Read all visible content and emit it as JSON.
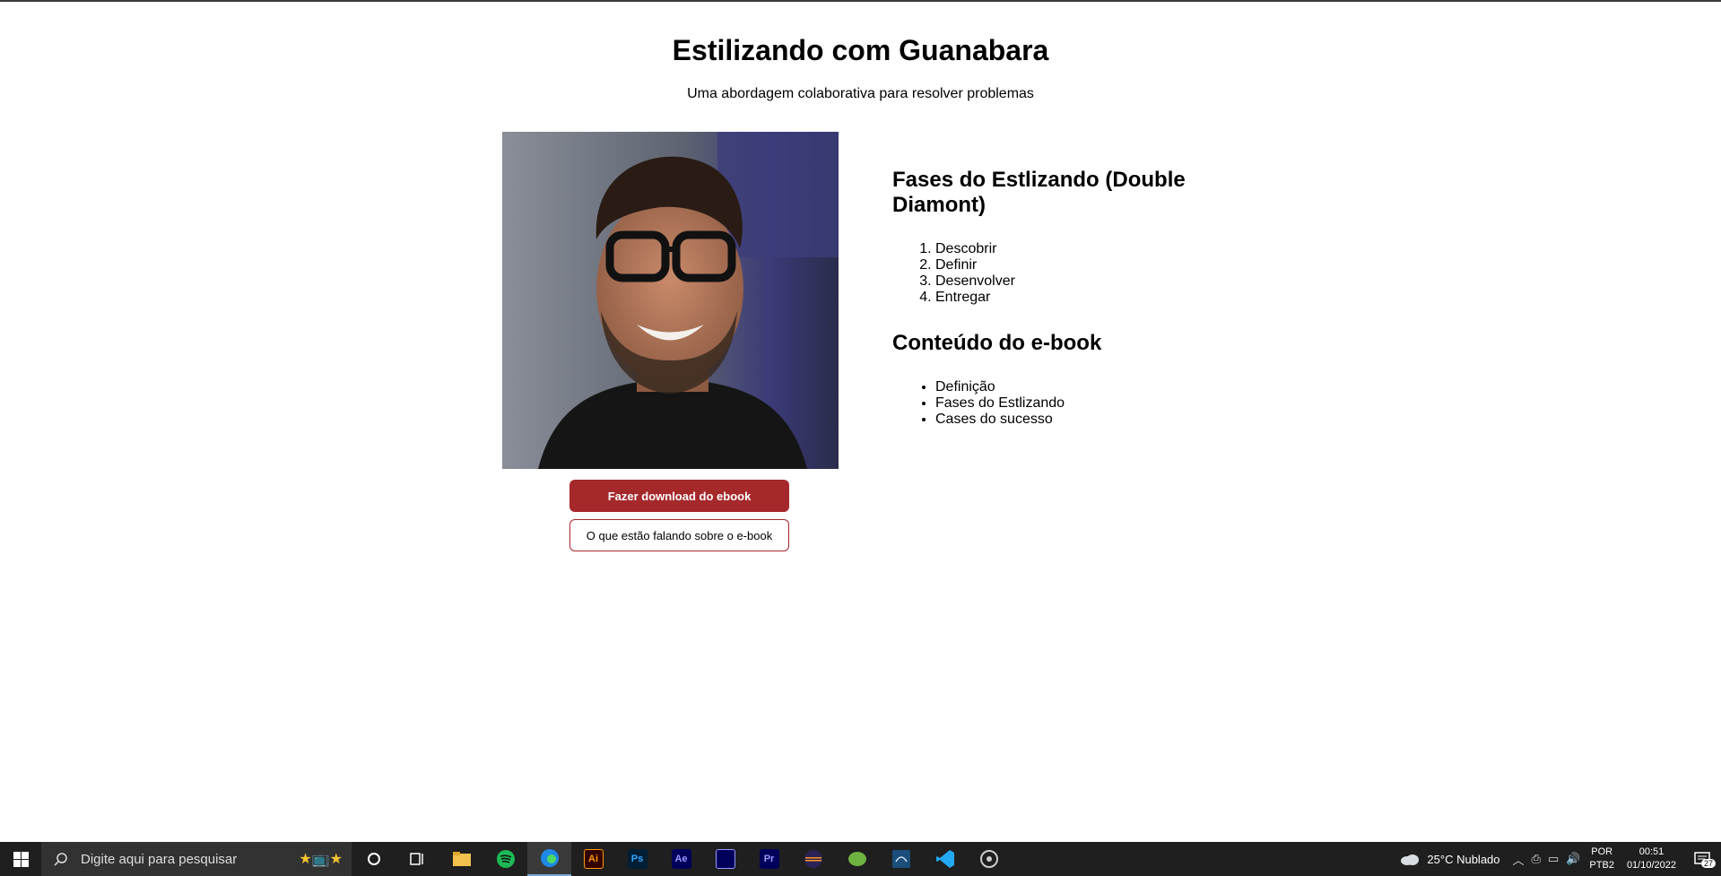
{
  "header": {
    "title": "Estilizando com Guanabara",
    "subtitle": "Uma abordagem colaborativa para resolver problemas"
  },
  "buttons": {
    "download": "Fazer download do ebook",
    "reviews": "O que estão falando sobre o e-book"
  },
  "phases": {
    "title": "Fases do Estlizando (Double Diamont)",
    "items": [
      "Descobrir",
      "Definir",
      "Desenvolver",
      "Entregar"
    ]
  },
  "ebook": {
    "title": "Conteúdo do e-book",
    "items": [
      "Definição",
      "Fases do Estlizando",
      "Cases do sucesso"
    ]
  },
  "taskbar": {
    "search_placeholder": "Digite aqui para pesquisar",
    "apps": [
      "Ai",
      "Ps",
      "Ae",
      "Pr"
    ],
    "weather": "25°C  Nublado",
    "lang_1": "POR",
    "lang_2": "PTB2",
    "time": "00:51",
    "date": "01/10/2022",
    "notifications": "27"
  }
}
